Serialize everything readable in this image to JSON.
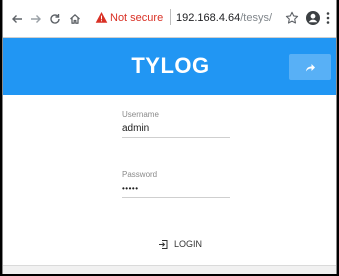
{
  "browser": {
    "security_label": "Not secure",
    "url_host": "192.168.4.64",
    "url_path": "/tesys/",
    "icons": [
      "back-icon",
      "forward-icon",
      "reload-icon",
      "home-icon",
      "warning-icon",
      "star-icon",
      "account-icon",
      "menu-icon"
    ]
  },
  "app": {
    "title": "TYLOG",
    "header_color": "#2196f3",
    "header_button_icon": "share-arrow-icon"
  },
  "form": {
    "username": {
      "label": "Username",
      "value": "admin"
    },
    "password": {
      "label": "Password",
      "value": "•••••"
    },
    "login_label": "LOGIN",
    "login_icon": "login-icon"
  }
}
